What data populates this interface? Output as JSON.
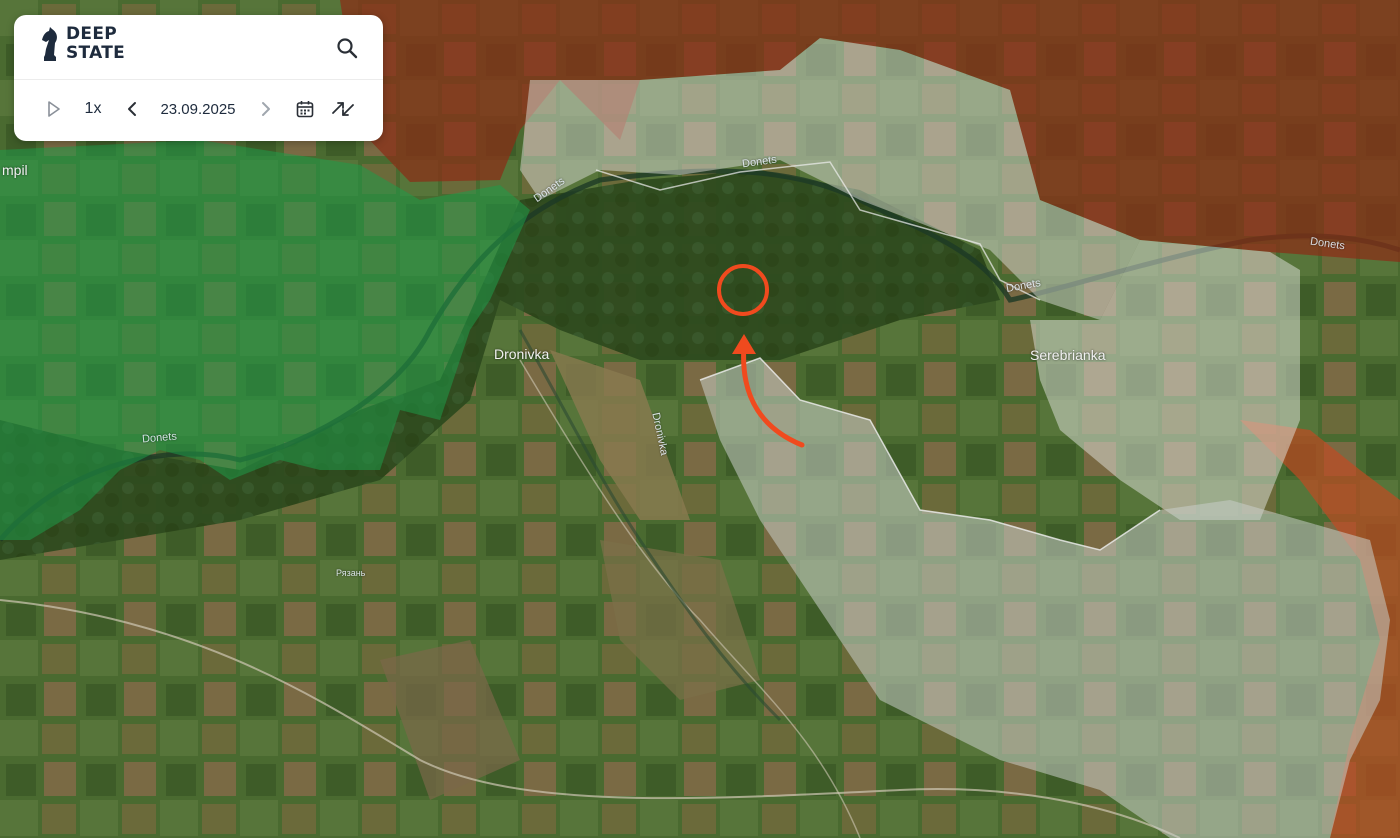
{
  "app": {
    "logo_line1": "DEEP",
    "logo_line2": "STATE"
  },
  "controls": {
    "speed": "1x",
    "date": "23.09.2025"
  },
  "map": {
    "labels": {
      "town_dronivka": "Dronivka",
      "town_serebrianka": "Serebrianka",
      "town_partial_left": "mpil",
      "town_small": "Рязань",
      "river_1": "Donets",
      "river_2": "Donets",
      "river_3": "Donets",
      "river_4": "Donets",
      "river_5": "Donets",
      "river_6": "Dronivka"
    },
    "colors": {
      "occupied_red": "#8b2e16",
      "liberated_green": "#1f9a48",
      "contested_gray": "#c8cdc8",
      "attack_arrow": "#f04a1e"
    }
  }
}
